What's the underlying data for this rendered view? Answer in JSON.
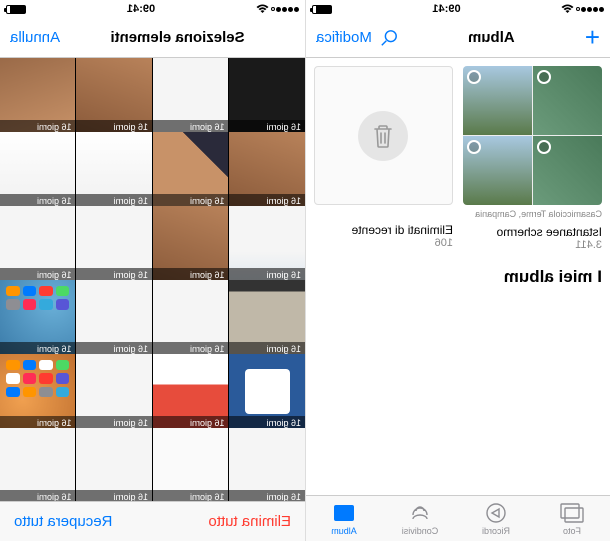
{
  "status": {
    "time": "09:41"
  },
  "left": {
    "nav": {
      "add": "+",
      "title": "Album",
      "edit": "Modifica"
    },
    "albums": [
      {
        "location": "Casamicciola Terme, Campania",
        "name": "Istantanee schermo",
        "count": "3.411"
      },
      {
        "name": "Eliminati di recente",
        "count": "106"
      }
    ],
    "section": "I miei album",
    "tabs": {
      "photos": "Foto",
      "memories": "Ricordi",
      "shared": "Condivisi",
      "albums": "Album"
    }
  },
  "right": {
    "nav": {
      "title": "Seleziona elementi",
      "cancel": "Annulla"
    },
    "photo_label": "16 giorni",
    "bottom": {
      "delete_all": "Elimina tutto",
      "recover_all": "Recupera tutto"
    }
  }
}
